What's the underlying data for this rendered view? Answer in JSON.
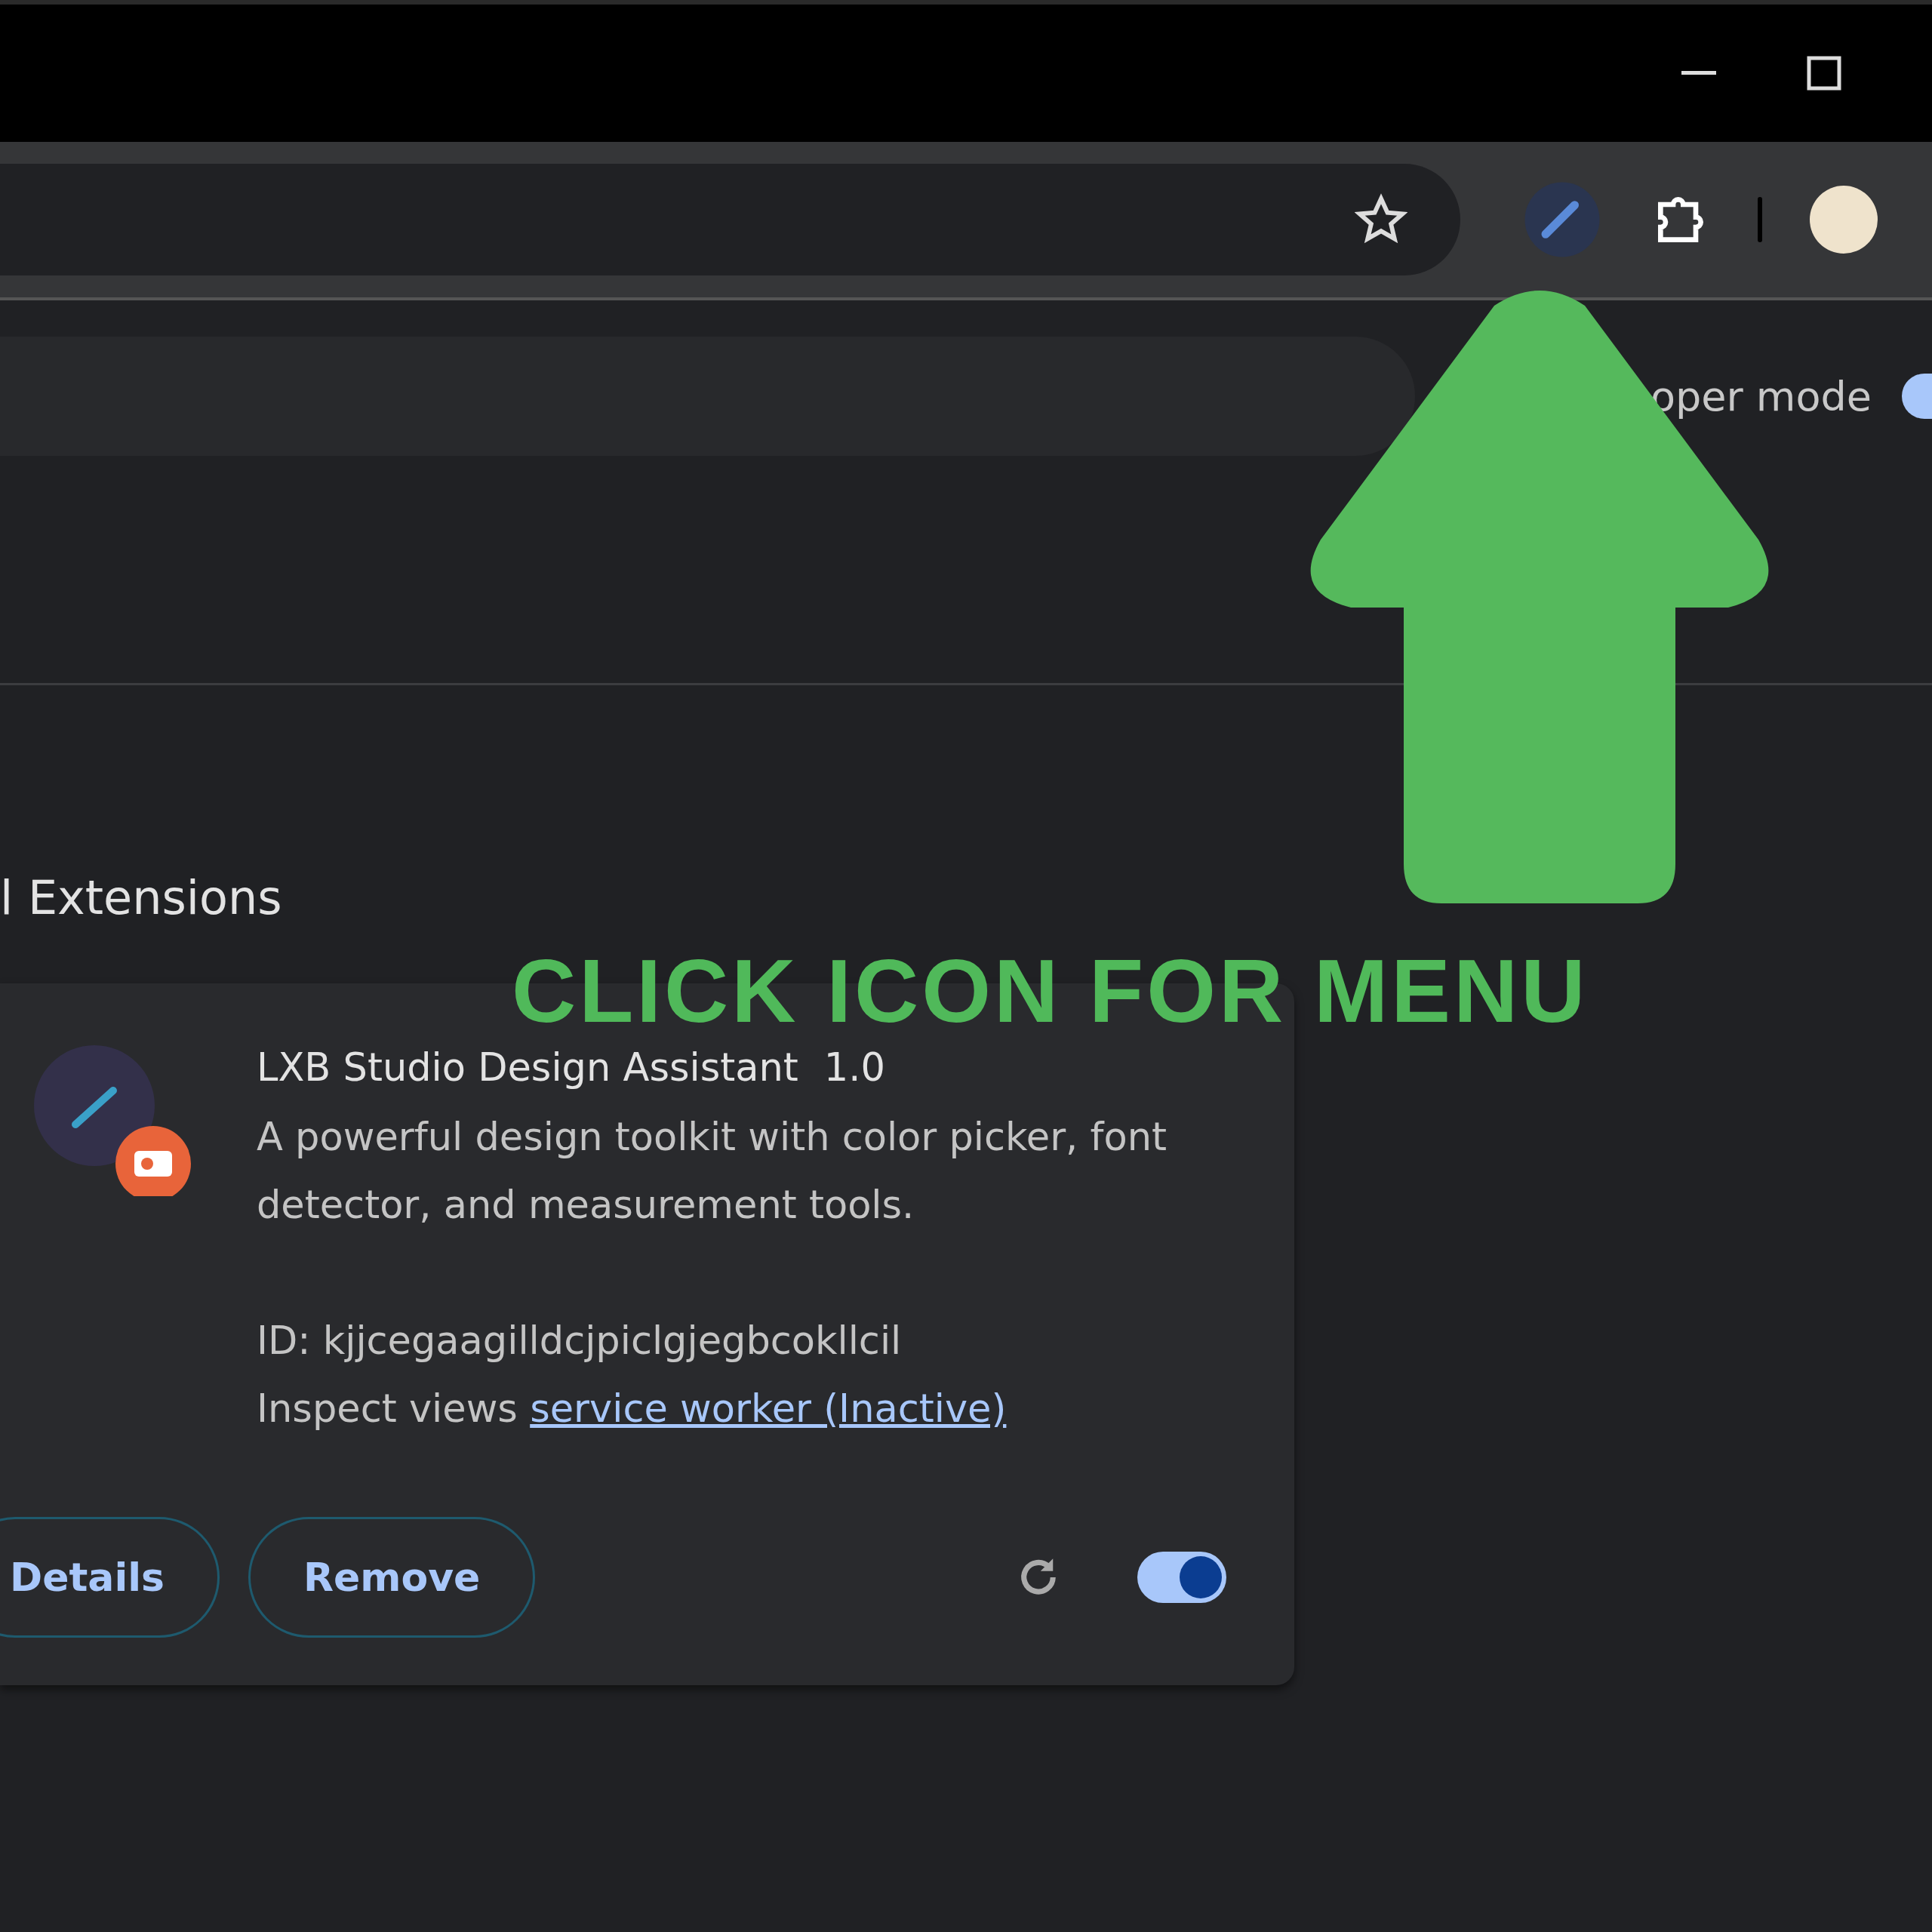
{
  "developer_mode": {
    "label": "oper mode",
    "on": true
  },
  "section_title": "l Extensions",
  "extension": {
    "name": "LXB Studio Design Assistant",
    "version": "1.0",
    "description": "A powerful design toolkit with color picker, font detector, and measurement tools.",
    "id_line": "ID: kjjcegaagilldcjpiclgjegbcokllcil",
    "inspect_label": "Inspect views",
    "inspect_link": "service worker (Inactive)",
    "buttons": [
      "Details",
      "Remove"
    ],
    "enabled": true
  },
  "overlay": {
    "caption": "CLICK ICON FOR MENU"
  }
}
